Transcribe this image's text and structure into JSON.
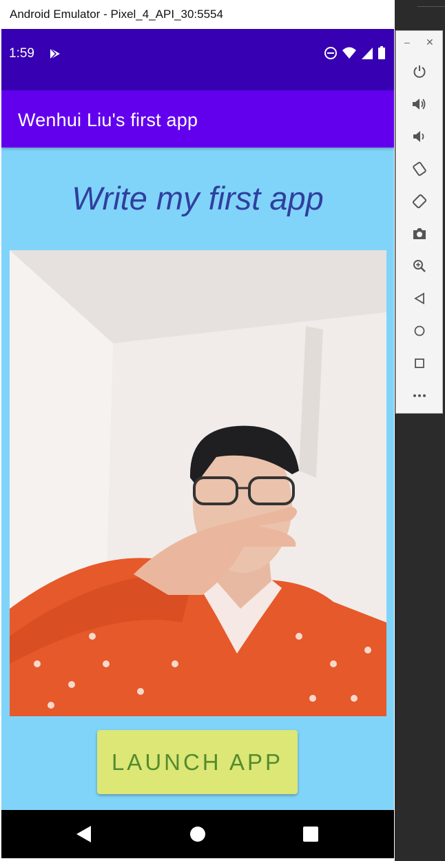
{
  "window": {
    "title": "Android Emulator - Pixel_4_API_30:5554"
  },
  "status_bar": {
    "time": "1:59"
  },
  "app_bar": {
    "title": "Wenhui Liu's first app"
  },
  "main": {
    "headline": "Write my first app",
    "button_label": "LAUNCH APP"
  },
  "side_toolbar": {
    "items": [
      "power-icon",
      "volume-up-icon",
      "volume-down-icon",
      "rotate-left-icon",
      "rotate-right-icon",
      "camera-icon",
      "zoom-icon",
      "back-icon",
      "home-icon",
      "overview-icon",
      "more-icon"
    ]
  },
  "colors": {
    "status_bar": "#3700b3",
    "app_bar": "#6200ee",
    "background": "#81d4f9",
    "headline": "#2f3f9e",
    "button_bg": "#dce775",
    "button_text": "#558b2f"
  }
}
